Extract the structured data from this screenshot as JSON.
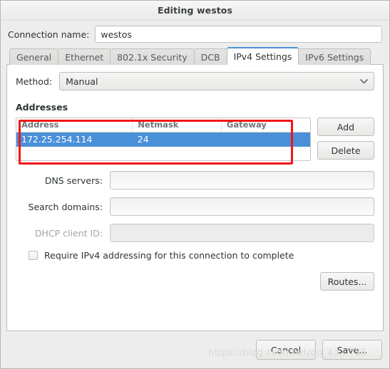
{
  "window": {
    "title": "Editing westos"
  },
  "connection": {
    "label": "Connection name:",
    "value": "westos",
    "placeholder": ""
  },
  "tabs": [
    {
      "label": "General",
      "active": false
    },
    {
      "label": "Ethernet",
      "active": false
    },
    {
      "label": "802.1x Security",
      "active": false
    },
    {
      "label": "DCB",
      "active": false
    },
    {
      "label": "IPv4 Settings",
      "active": true
    },
    {
      "label": "IPv6 Settings",
      "active": false
    }
  ],
  "ipv4": {
    "method": {
      "label": "Method:",
      "value": "Manual",
      "chevron": "chevron-down-icon"
    },
    "addresses": {
      "title": "Addresses",
      "columns": [
        "Address",
        "Netmask",
        "Gateway"
      ],
      "rows": [
        {
          "address": "172.25.254.114",
          "netmask": "24",
          "gateway": "",
          "selected": true
        }
      ],
      "add_label": "Add",
      "delete_label": "Delete"
    },
    "dns_servers": {
      "label": "DNS servers:",
      "value": "",
      "placeholder": ""
    },
    "search_domains": {
      "label": "Search domains:",
      "value": "",
      "placeholder": ""
    },
    "dhcp_client_id": {
      "label": "DHCP client ID:",
      "value": "",
      "placeholder": "",
      "disabled": true
    },
    "require_ipv4": {
      "label": "Require IPv4 addressing for this connection to complete",
      "checked": false
    },
    "routes_label": "Routes..."
  },
  "actions": {
    "cancel_label": "Cancel",
    "save_label": "Save..."
  },
  "annotation": {
    "color": "#f41616"
  },
  "watermark": {
    "text": "https://blog.csdn.net/qq_43...755"
  }
}
